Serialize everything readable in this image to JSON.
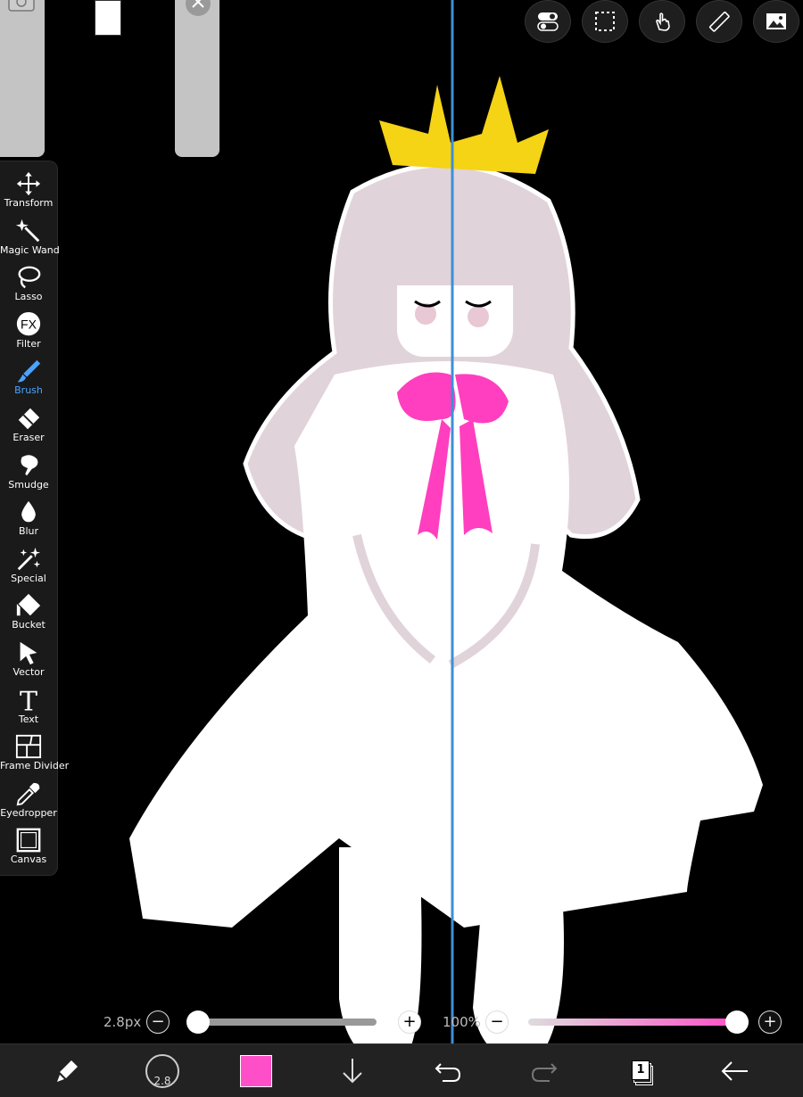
{
  "tools": [
    {
      "label": "Transform",
      "icon": "move-arrows-icon"
    },
    {
      "label": "Magic Wand",
      "icon": "magic-wand-icon"
    },
    {
      "label": "Lasso",
      "icon": "lasso-icon"
    },
    {
      "label": "Filter",
      "icon": "fx-icon"
    },
    {
      "label": "Brush",
      "icon": "brush-icon",
      "active": true
    },
    {
      "label": "Eraser",
      "icon": "eraser-icon"
    },
    {
      "label": "Smudge",
      "icon": "smudge-icon"
    },
    {
      "label": "Blur",
      "icon": "droplet-icon"
    },
    {
      "label": "Special",
      "icon": "sparkle-icon"
    },
    {
      "label": "Bucket",
      "icon": "bucket-icon"
    },
    {
      "label": "Vector",
      "icon": "cursor-arrow-icon"
    },
    {
      "label": "Text",
      "icon": "text-t-icon"
    },
    {
      "label": "Frame Divider",
      "icon": "frame-divider-icon"
    },
    {
      "label": "Eyedropper",
      "icon": "eyedropper-icon"
    },
    {
      "label": "Canvas",
      "icon": "canvas-frame-icon"
    }
  ],
  "top_tools": [
    "toggle-icon",
    "selection-icon",
    "touch-gesture-icon",
    "ruler-icon",
    "image-icon"
  ],
  "sliders": {
    "brush_size_label": "2.8px",
    "brush_size_level": 0.0,
    "opacity_label": "100%",
    "opacity_level": 1.0,
    "minus": "−",
    "plus": "+"
  },
  "bottom_bar": {
    "brush_size_value": "2.8",
    "layer_count": "1",
    "current_color": "#ff4fc8"
  },
  "colors": {
    "accent": "#4aa3ff",
    "guide_line": "#3d8fd6",
    "crown": "#f5d315",
    "bow": "#ff3fbf",
    "hair": "#e1d3da"
  }
}
